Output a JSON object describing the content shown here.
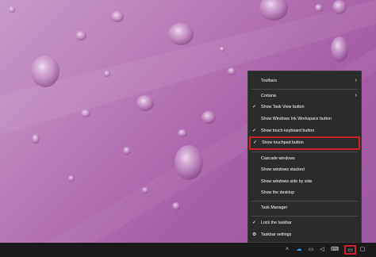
{
  "context_menu": {
    "items": [
      {
        "label": "Toolbars",
        "checked": false,
        "submenu": true
      },
      {
        "label": "Cortana",
        "checked": false,
        "submenu": true
      },
      {
        "label": "Show Task View button",
        "checked": true,
        "submenu": false
      },
      {
        "label": "Show Windows Ink Workspace button",
        "checked": false,
        "submenu": false
      },
      {
        "label": "Show touch keyboard button",
        "checked": true,
        "submenu": false
      },
      {
        "label": "Show touchpad button",
        "checked": true,
        "submenu": false,
        "highlighted": true
      },
      {
        "label": "Cascade windows",
        "checked": false,
        "submenu": false
      },
      {
        "label": "Show windows stacked",
        "checked": false,
        "submenu": false
      },
      {
        "label": "Show windows side by side",
        "checked": false,
        "submenu": false
      },
      {
        "label": "Show the desktop",
        "checked": false,
        "submenu": false
      },
      {
        "label": "Task Manager",
        "checked": false,
        "submenu": false
      },
      {
        "label": "Lock the taskbar",
        "checked": true,
        "submenu": false
      },
      {
        "label": "Taskbar settings",
        "checked": false,
        "submenu": false,
        "icon": "gear-icon"
      }
    ],
    "check_glyph": "✓",
    "arrow_glyph": "›"
  },
  "taskbar": {
    "tray_icons": [
      "chevron-up-icon",
      "people-icon",
      "network-icon",
      "volume-icon",
      "touch-keyboard-icon",
      "touchpad-icon",
      "notification-icon"
    ],
    "highlight_color": "#d0202a"
  }
}
